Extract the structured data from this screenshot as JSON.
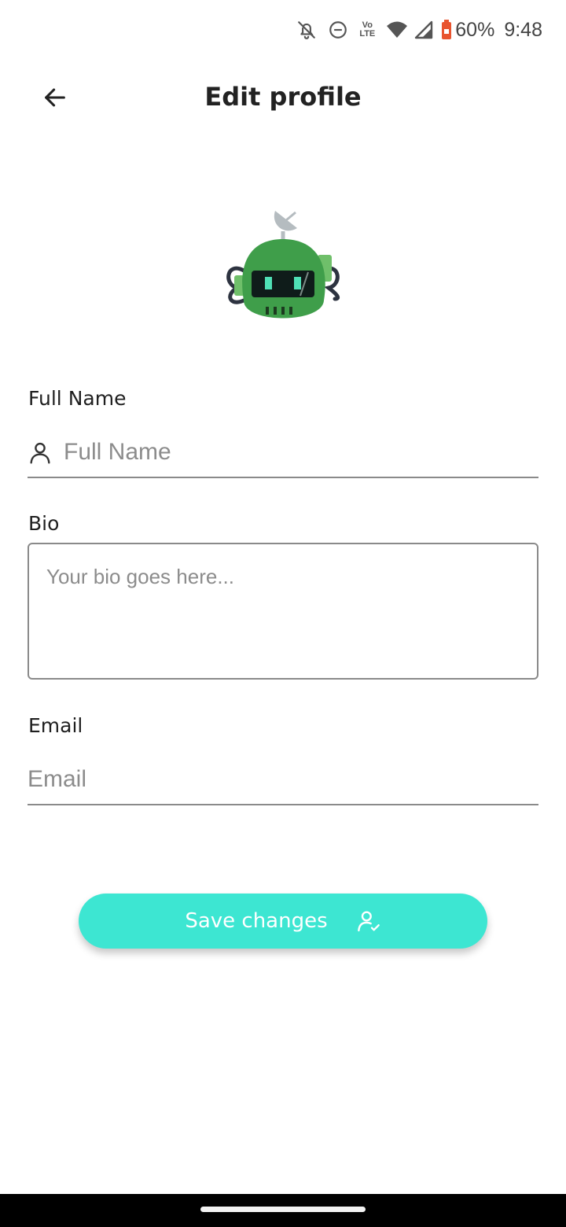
{
  "status_bar": {
    "icons": [
      "bell-off-icon",
      "do-not-disturb-icon",
      "volte-icon",
      "wifi-icon",
      "signal-icon",
      "battery-icon"
    ],
    "lte_top": "Vo",
    "lte_bottom": "LTE",
    "battery_percent": "60%",
    "time": "9:48",
    "battery_color": "#e8542f"
  },
  "app_bar": {
    "title": "Edit profile",
    "back_icon": "arrow-left-icon"
  },
  "avatar": {
    "icon": "robot-avatar",
    "body_color": "#3f9e4a"
  },
  "form": {
    "full_name": {
      "label": "Full Name",
      "placeholder": "Full Name",
      "value": "",
      "icon": "person-icon"
    },
    "bio": {
      "label": "Bio",
      "placeholder": "Your bio goes here...",
      "value": ""
    },
    "email": {
      "label": "Email",
      "placeholder": "Email",
      "value": ""
    }
  },
  "save_button": {
    "label": "Save changes",
    "icon": "user-check-icon",
    "color": "#3de6d2"
  }
}
